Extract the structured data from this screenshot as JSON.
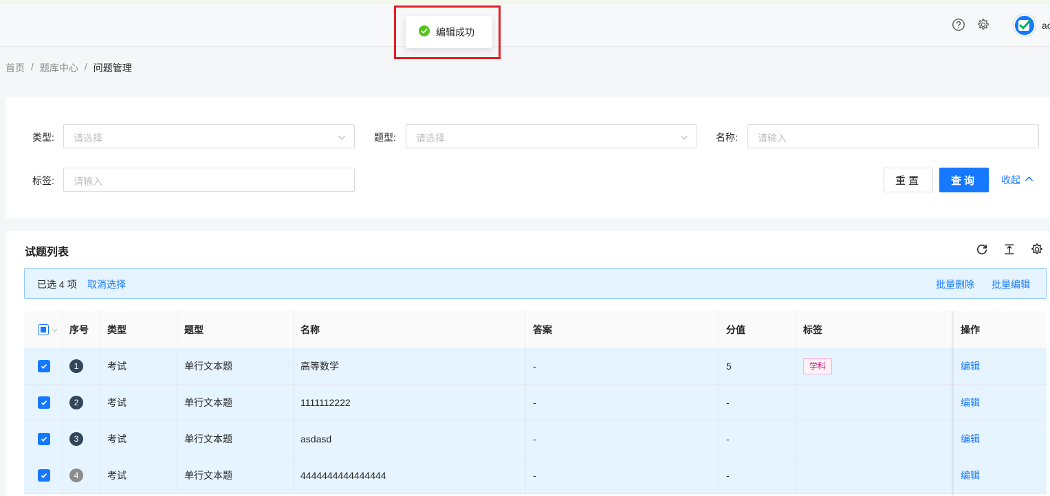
{
  "toast": {
    "text": "编辑成功"
  },
  "header": {
    "username": "ac"
  },
  "breadcrumb": {
    "home": "首页",
    "center": "题库中心",
    "current": "问题管理",
    "sep": "/"
  },
  "filters": {
    "type_label": "类型:",
    "type_placeholder": "请选择",
    "qtype_label": "题型:",
    "qtype_placeholder": "请选择",
    "name_label": "名称:",
    "name_placeholder": "请输入",
    "tag_label": "标签:",
    "tag_placeholder": "请输入",
    "reset": "重置",
    "query": "查询",
    "collapse": "收起"
  },
  "table": {
    "title": "试题列表",
    "selection": {
      "count_text": "已选 4 项",
      "cancel": "取消选择",
      "batch_delete": "批量删除",
      "batch_edit": "批量编辑"
    },
    "columns": [
      "序号",
      "类型",
      "题型",
      "名称",
      "答案",
      "分值",
      "标签",
      "操作"
    ],
    "rows": [
      {
        "index": "1",
        "type": "考试",
        "qtype": "单行文本题",
        "name": "高等数学",
        "answer": "-",
        "score": "5",
        "tag": "学科",
        "action": "编辑"
      },
      {
        "index": "2",
        "type": "考试",
        "qtype": "单行文本题",
        "name": "1111112222",
        "answer": "-",
        "score": "-",
        "tag": "",
        "action": "编辑"
      },
      {
        "index": "3",
        "type": "考试",
        "qtype": "单行文本题",
        "name": "asdasd",
        "answer": "-",
        "score": "-",
        "tag": "",
        "action": "编辑"
      },
      {
        "index": "4",
        "type": "考试",
        "qtype": "单行文本题",
        "name": "4444444444444444",
        "answer": "-",
        "score": "-",
        "tag": "",
        "action": "编辑"
      }
    ]
  },
  "icons": {
    "toast": "check-circle-icon",
    "help": "question-circle-icon",
    "settings": "gear-icon",
    "refresh": "reload-icon",
    "density": "column-height-icon",
    "table_settings": "gear-icon",
    "dropdown": "chevron-down-icon",
    "collapse": "chevron-up-icon",
    "checkbox": "check-icon"
  },
  "colors": {
    "primary": "#1677ff",
    "success": "#52c41a",
    "highlight_frame": "#e02020",
    "tag": "#c41d7f",
    "row_selected": "#e6f4ff"
  }
}
